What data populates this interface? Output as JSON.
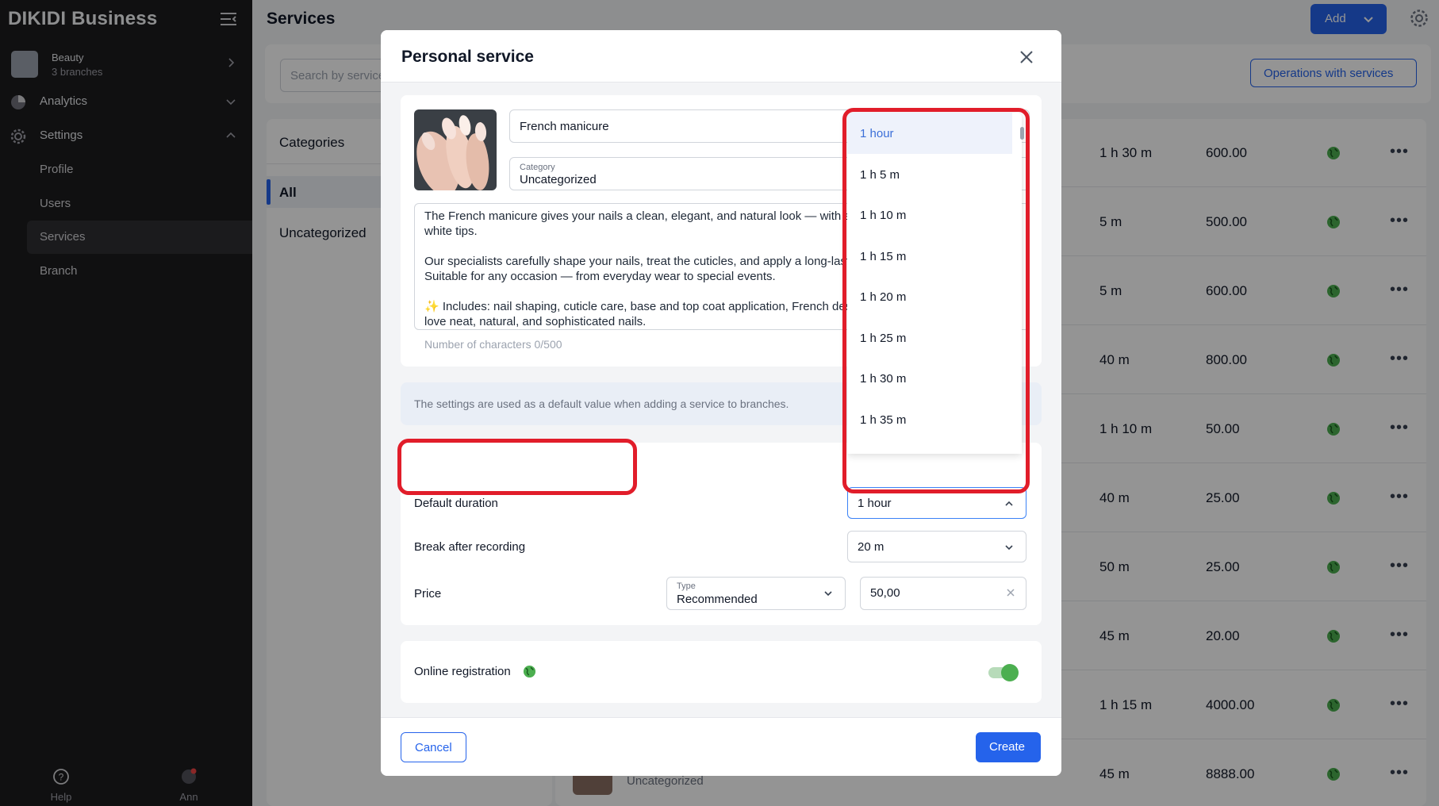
{
  "app": {
    "brand": "DIKIDI Business"
  },
  "sidebar": {
    "org": {
      "name": "Beauty",
      "sub": "3 branches"
    },
    "nav": [
      {
        "label": "Analytics",
        "icon": "pie-chart-icon"
      },
      {
        "label": "Settings",
        "icon": "gear-icon"
      }
    ],
    "sub": [
      "Profile",
      "Users",
      "Services",
      "Branch"
    ],
    "footer": {
      "help": "Help",
      "user": "Ann"
    }
  },
  "main": {
    "title": "Services",
    "add_label": "Add",
    "search_placeholder": "Search by service",
    "ops_label": "Operations with services",
    "categories_title": "Categories",
    "categories": [
      "All",
      "Uncategorized"
    ],
    "rows": [
      {
        "duration": "1 h 30 m",
        "price": "600.00"
      },
      {
        "duration": "5 m",
        "price": "500.00"
      },
      {
        "duration": "5 m",
        "price": "600.00"
      },
      {
        "duration": "40 m",
        "price": "800.00"
      },
      {
        "duration": "1 h 10 m",
        "price": "50.00"
      },
      {
        "duration": "40 m",
        "price": "25.00"
      },
      {
        "duration": "50 m",
        "price": "25.00"
      },
      {
        "duration": "45 m",
        "price": "20.00"
      },
      {
        "duration": "1 h 15 m",
        "price": "4000.00"
      },
      {
        "duration": "45 m",
        "price": "8888.00"
      }
    ],
    "last_row_category": "Uncategorized"
  },
  "modal": {
    "title": "Personal service",
    "name": "French manicure",
    "category_label": "Category",
    "category_value": "Uncategorized",
    "description": [
      "The French manicure gives your nails a clean, elegant, and natural look — with a soft pink base and perfectly white tips.",
      "Our specialists carefully shape your nails, treat the cuticles, and apply a long-lasting coating for a flawless finish. Suitable for any occasion — from everyday wear to special events.",
      "✨ Includes: nail shaping, cuticle care, base and top coat application, French design. 💅 Perfect for: those who love neat, natural, and sophisticated nails."
    ],
    "char_count": "Number of characters 0/500",
    "info": "The settings are used as a default value when adding a service to branches.",
    "default_duration_label": "Default duration",
    "default_duration_value": "1 hour",
    "break_label": "Break after recording",
    "break_value": "20 m",
    "price_label": "Price",
    "price_type_label": "Type",
    "price_type_value": "Recommended",
    "price_value": "50,00",
    "online_label": "Online registration",
    "online_enabled": true,
    "cancel_label": "Cancel",
    "create_label": "Create"
  },
  "dropdown": {
    "options": [
      "1 hour",
      "1 h 5 m",
      "1 h 10 m",
      "1 h 15 m",
      "1 h 20 m",
      "1 h 25 m",
      "1 h 30 m",
      "1 h 35 m"
    ],
    "selected": "1 hour"
  },
  "colors": {
    "accent": "#2563eb",
    "highlight": "#e11d2a",
    "toggle_on": "#4caf50",
    "sidebar": "#1c1c1e"
  }
}
